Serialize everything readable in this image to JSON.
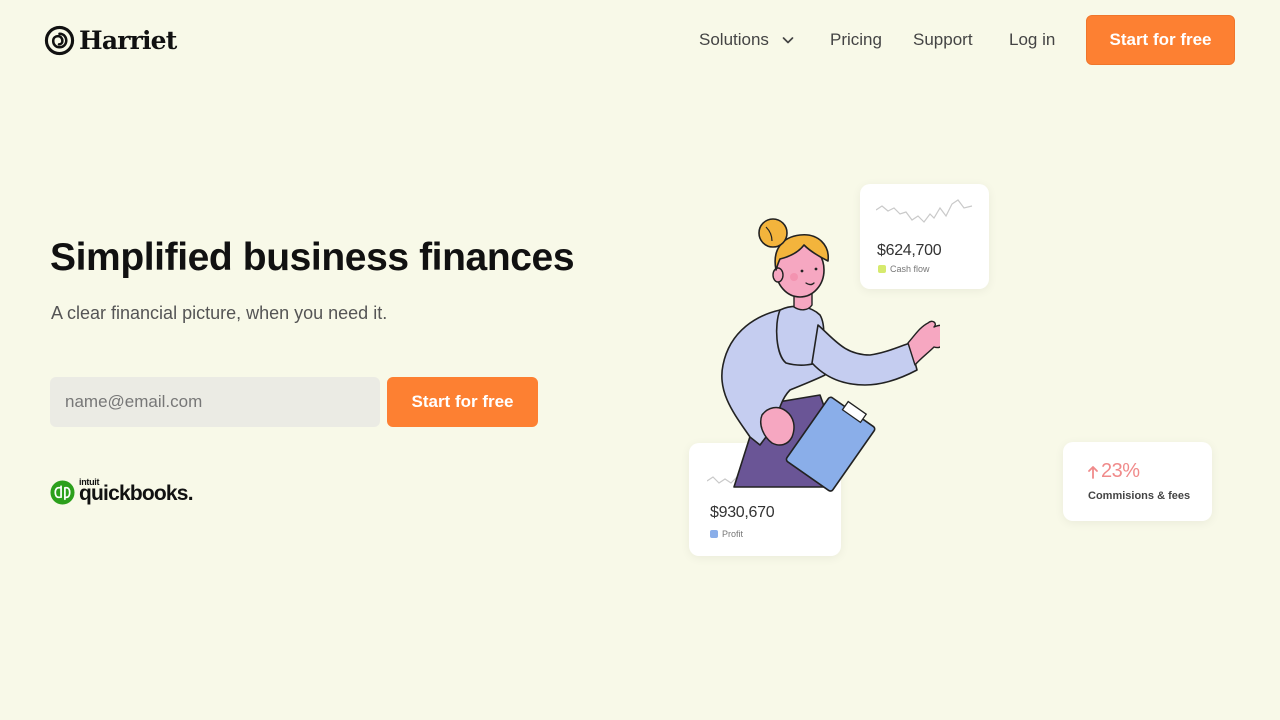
{
  "brand": {
    "name": "Harriet",
    "accent_color": "#fd8032",
    "background_color": "#f8f9e8"
  },
  "nav": {
    "items": [
      {
        "label": "Solutions",
        "has_dropdown": true
      },
      {
        "label": "Pricing"
      },
      {
        "label": "Support"
      },
      {
        "label": "Log in"
      }
    ],
    "cta_label": "Start for free"
  },
  "hero": {
    "title": "Simplified business finances",
    "subtitle": "A clear financial picture, when you need it.",
    "email_placeholder": "name@email.com",
    "cta_label": "Start for free",
    "partner": {
      "brand_line": "intuit",
      "name": "quickbooks.",
      "color": "#2ca01c"
    }
  },
  "cards": {
    "cash_flow": {
      "value": "$624,700",
      "label": "Cash flow",
      "swatch_color": "#d6ea6e"
    },
    "profit": {
      "value": "$930,670",
      "label": "Profit",
      "swatch_color": "#8aaee9"
    },
    "commissions": {
      "value": "23%",
      "label": "Commisions & fees",
      "color": "#f08a8a",
      "arrow": "up-arrow-icon"
    }
  }
}
